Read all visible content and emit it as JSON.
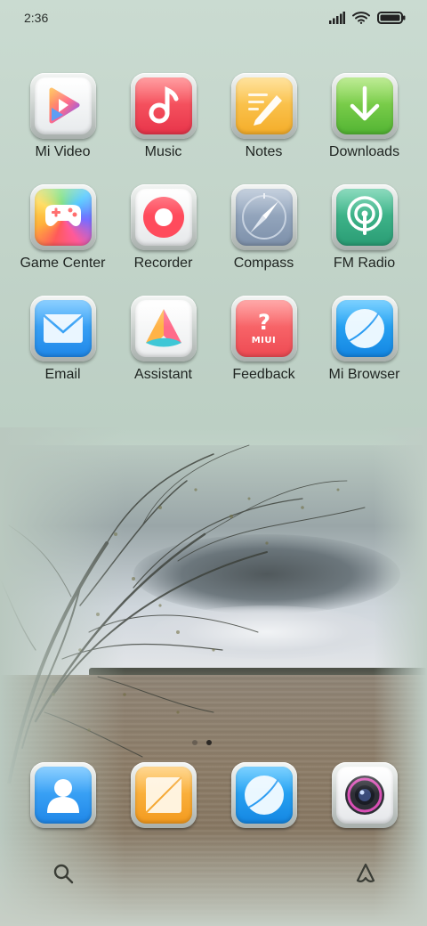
{
  "status_bar": {
    "time": "2:36",
    "icons": [
      "signal-icon",
      "wifi-icon",
      "battery-icon"
    ]
  },
  "apps": [
    {
      "label": "Mi Video",
      "icon": "mi-video-icon"
    },
    {
      "label": "Music",
      "icon": "music-icon"
    },
    {
      "label": "Notes",
      "icon": "notes-icon"
    },
    {
      "label": "Downloads",
      "icon": "downloads-icon"
    },
    {
      "label": "Game Center",
      "icon": "game-center-icon"
    },
    {
      "label": "Recorder",
      "icon": "recorder-icon"
    },
    {
      "label": "Compass",
      "icon": "compass-icon"
    },
    {
      "label": "FM Radio",
      "icon": "fm-radio-icon"
    },
    {
      "label": "Email",
      "icon": "email-icon"
    },
    {
      "label": "Assistant",
      "icon": "assistant-icon"
    },
    {
      "label": "Feedback",
      "icon": "feedback-icon",
      "badge_text": "MIUI"
    },
    {
      "label": "Mi Browser",
      "icon": "mi-browser-icon"
    }
  ],
  "page_indicator": {
    "pages": 2,
    "current": 2
  },
  "dock": [
    {
      "icon": "contacts-icon"
    },
    {
      "icon": "messages-icon"
    },
    {
      "icon": "browser-icon"
    },
    {
      "icon": "camera-icon"
    }
  ],
  "bottom_bar": {
    "left_icon": "search-icon",
    "right_icon": "assistant-shortcut-icon"
  }
}
